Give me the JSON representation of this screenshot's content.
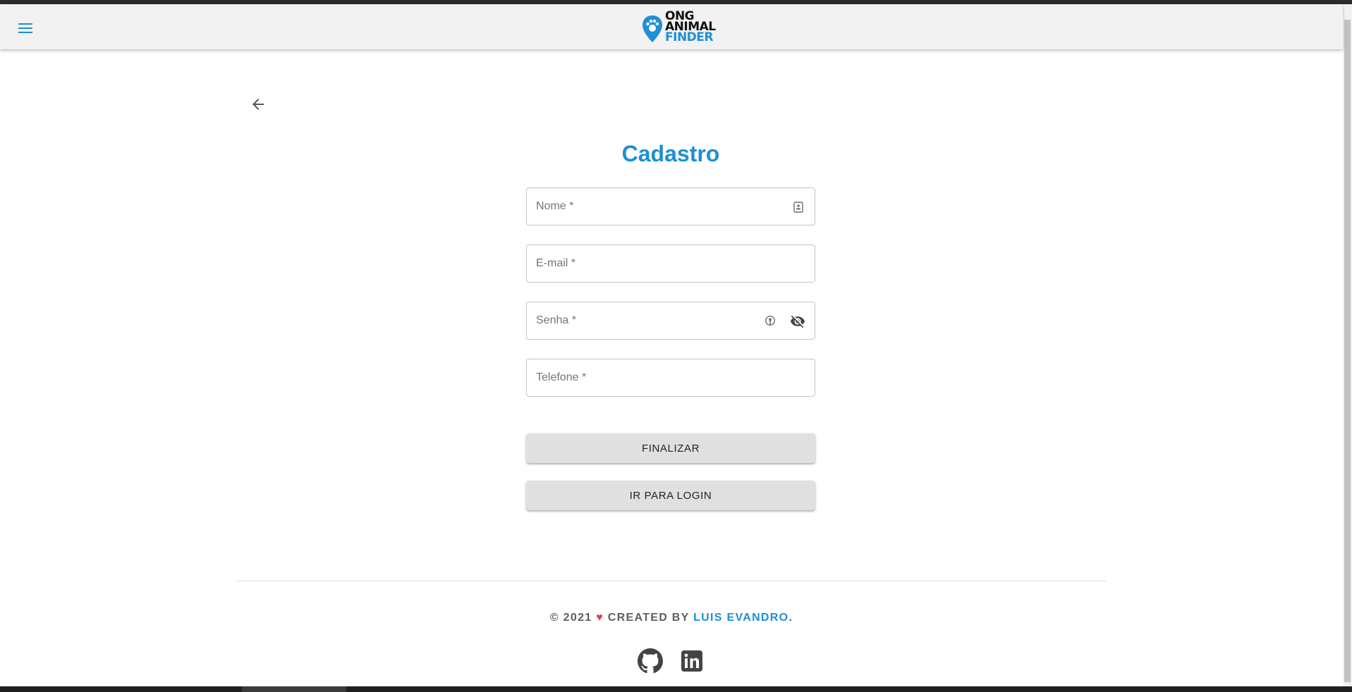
{
  "header": {
    "logo_line1": "ONG",
    "logo_line2": "ANIMAL",
    "logo_line3": "FINDER",
    "menu_icon": "hamburger-menu-icon"
  },
  "colors": {
    "accent": "#1e8fd6",
    "heart": "#e53958",
    "appbar": "#f2f2f2",
    "button": "#e0e0e0"
  },
  "page": {
    "back_icon": "arrow-left-icon",
    "title": "Cadastro"
  },
  "form": {
    "name_placeholder": "Nome *",
    "email_placeholder": "E-mail *",
    "password_placeholder": "Senha *",
    "phone_placeholder": "Telefone *",
    "name_icon": "contact-card-icon",
    "password_icons": [
      "password-manager-key-icon",
      "eye-off-icon"
    ],
    "submit_label": "FINALIZAR",
    "login_label": "IR PARA LOGIN"
  },
  "footer": {
    "copyright": "© 2021",
    "heart": "♥",
    "created_by": "CREATED BY",
    "author": "LUIS EVANDRO",
    "period": ".",
    "social": [
      "github-icon",
      "linkedin-icon"
    ]
  }
}
